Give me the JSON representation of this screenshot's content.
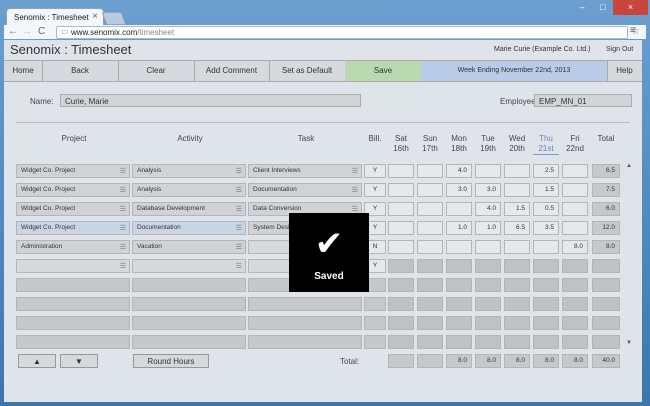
{
  "browser": {
    "tab_title": "Senomix : Timesheet",
    "tab_close": "×",
    "url_host": "www.senomix.com",
    "url_path": "/timesheet",
    "back": "←",
    "forward": "→",
    "reload": "C",
    "star": "☆",
    "menu": "≡",
    "window_controls": [
      "–",
      "□",
      "×"
    ]
  },
  "app": {
    "brand": "Senomix : Timesheet",
    "user": "Marie Curie  (Example Co. Ltd.)",
    "sign_out": "Sign Out"
  },
  "nav": {
    "home": "Home",
    "back": "Back",
    "clear": "Clear",
    "add_comment": "Add Comment",
    "set_default": "Set as Default",
    "save": "Save",
    "week": "Week Ending November 22nd, 2013",
    "help": "Help"
  },
  "form": {
    "name_label": "Name:",
    "name_value": "Curie, Marie",
    "employee_label": "Employee No.:",
    "employee_value": "EMP_MN_01"
  },
  "columns": {
    "project": "Project",
    "activity": "Activity",
    "task": "Task",
    "bill": "Bill.",
    "days": [
      {
        "d": "Sat",
        "n": "16th"
      },
      {
        "d": "Sun",
        "n": "17th"
      },
      {
        "d": "Mon",
        "n": "18th"
      },
      {
        "d": "Tue",
        "n": "19th"
      },
      {
        "d": "Wed",
        "n": "20th"
      },
      {
        "d": "Thu",
        "n": "21st"
      },
      {
        "d": "Fri",
        "n": "22nd"
      }
    ],
    "total": "Total"
  },
  "rows": [
    {
      "project": "Widget Co. Project",
      "activity": "Analysis",
      "task": "Client Interviews",
      "bill": "Y",
      "hours": [
        "",
        "",
        "4.0",
        "",
        "",
        "2.5",
        ""
      ],
      "total": "6.5"
    },
    {
      "project": "Widget Co. Project",
      "activity": "Analysis",
      "task": "Documentation",
      "bill": "Y",
      "hours": [
        "",
        "",
        "3.0",
        "3.0",
        "",
        "1.5",
        ""
      ],
      "total": "7.5"
    },
    {
      "project": "Widget Co. Project",
      "activity": "Database Development",
      "task": "Data Conversion",
      "bill": "Y",
      "hours": [
        "",
        "",
        "",
        "4.0",
        "1.5",
        "0.5",
        ""
      ],
      "total": "6.0"
    },
    {
      "project": "Widget Co. Project",
      "activity": "Documentation",
      "task": "System Design",
      "bill": "Y",
      "hours": [
        "",
        "",
        "1.0",
        "1.0",
        "6.5",
        "3.5",
        ""
      ],
      "total": "12.0"
    },
    {
      "project": "Administration",
      "activity": "Vacation",
      "task": "",
      "bill": "N",
      "hours": [
        "",
        "",
        "",
        "",
        "",
        "",
        "8.0"
      ],
      "total": "8.0"
    }
  ],
  "footer": {
    "up": "▲",
    "down": "▼",
    "round": "Round Hours",
    "total_label": "Total:",
    "day_totals": [
      "",
      "",
      "8.0",
      "8.0",
      "8.0",
      "8.0",
      "8.0"
    ],
    "grand_total": "40.0",
    "new_row_bill": "Y"
  },
  "overlay": {
    "check": "✔",
    "text": "Saved"
  },
  "scroll": {
    "up": "▲",
    "down": "▼"
  },
  "icons": {
    "list": "☰"
  }
}
